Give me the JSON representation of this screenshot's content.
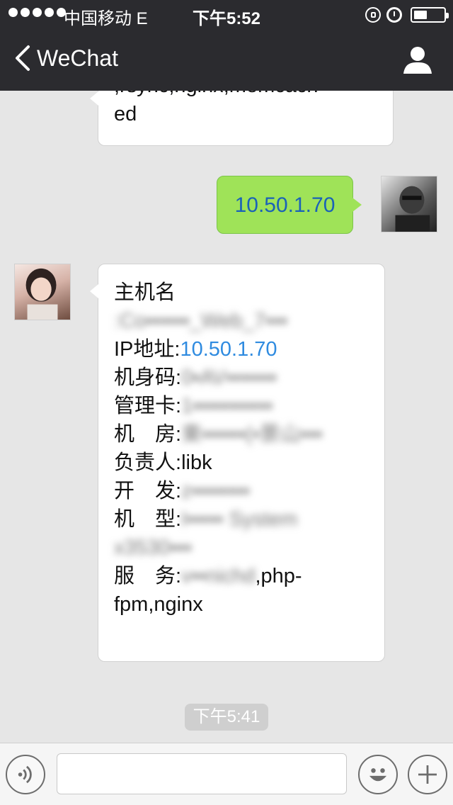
{
  "status_bar": {
    "carrier": "中国移动  E",
    "time": "下午5:52"
  },
  "nav": {
    "back_label": "WeChat"
  },
  "messages": [
    {
      "side": "in",
      "lines": [
        ",rsync,nginx,memcach",
        "ed"
      ]
    },
    {
      "side": "out",
      "text": "10.50.1.70"
    },
    {
      "side": "in",
      "hostname_label": "主机名",
      "hostname_value": ":Co▪▪▪▪▪▪_Web_7▪▪▪",
      "ip_label": "IP地址:",
      "ip_value": "10.50.1.70",
      "serial_label": "机身码:",
      "serial_value": "0▪AV▪▪▪▪▪▪▪",
      "mgmt_label": "管理卡:",
      "mgmt_value": "1▪▪▪▪▪▪▪▪▪▪▪",
      "room_label": "机　房:",
      "room_value": "東▪▪▪▪▪▪(▪景山▪▪▪",
      "owner_label": "负责人:",
      "owner_value": "libk",
      "dev_label": "开　发:",
      "dev_value": "z▪▪▪▪▪▪▪▪",
      "model_label": "机　型:",
      "model_value": "I▪▪▪▪▪ System x3530▪▪▪",
      "service_label": "服　务:",
      "service_value_blur": "v▪▪nichd",
      "service_value": ",php-fpm,nginx"
    }
  ],
  "time_badge": "下午5:41",
  "input": {
    "placeholder": ""
  }
}
